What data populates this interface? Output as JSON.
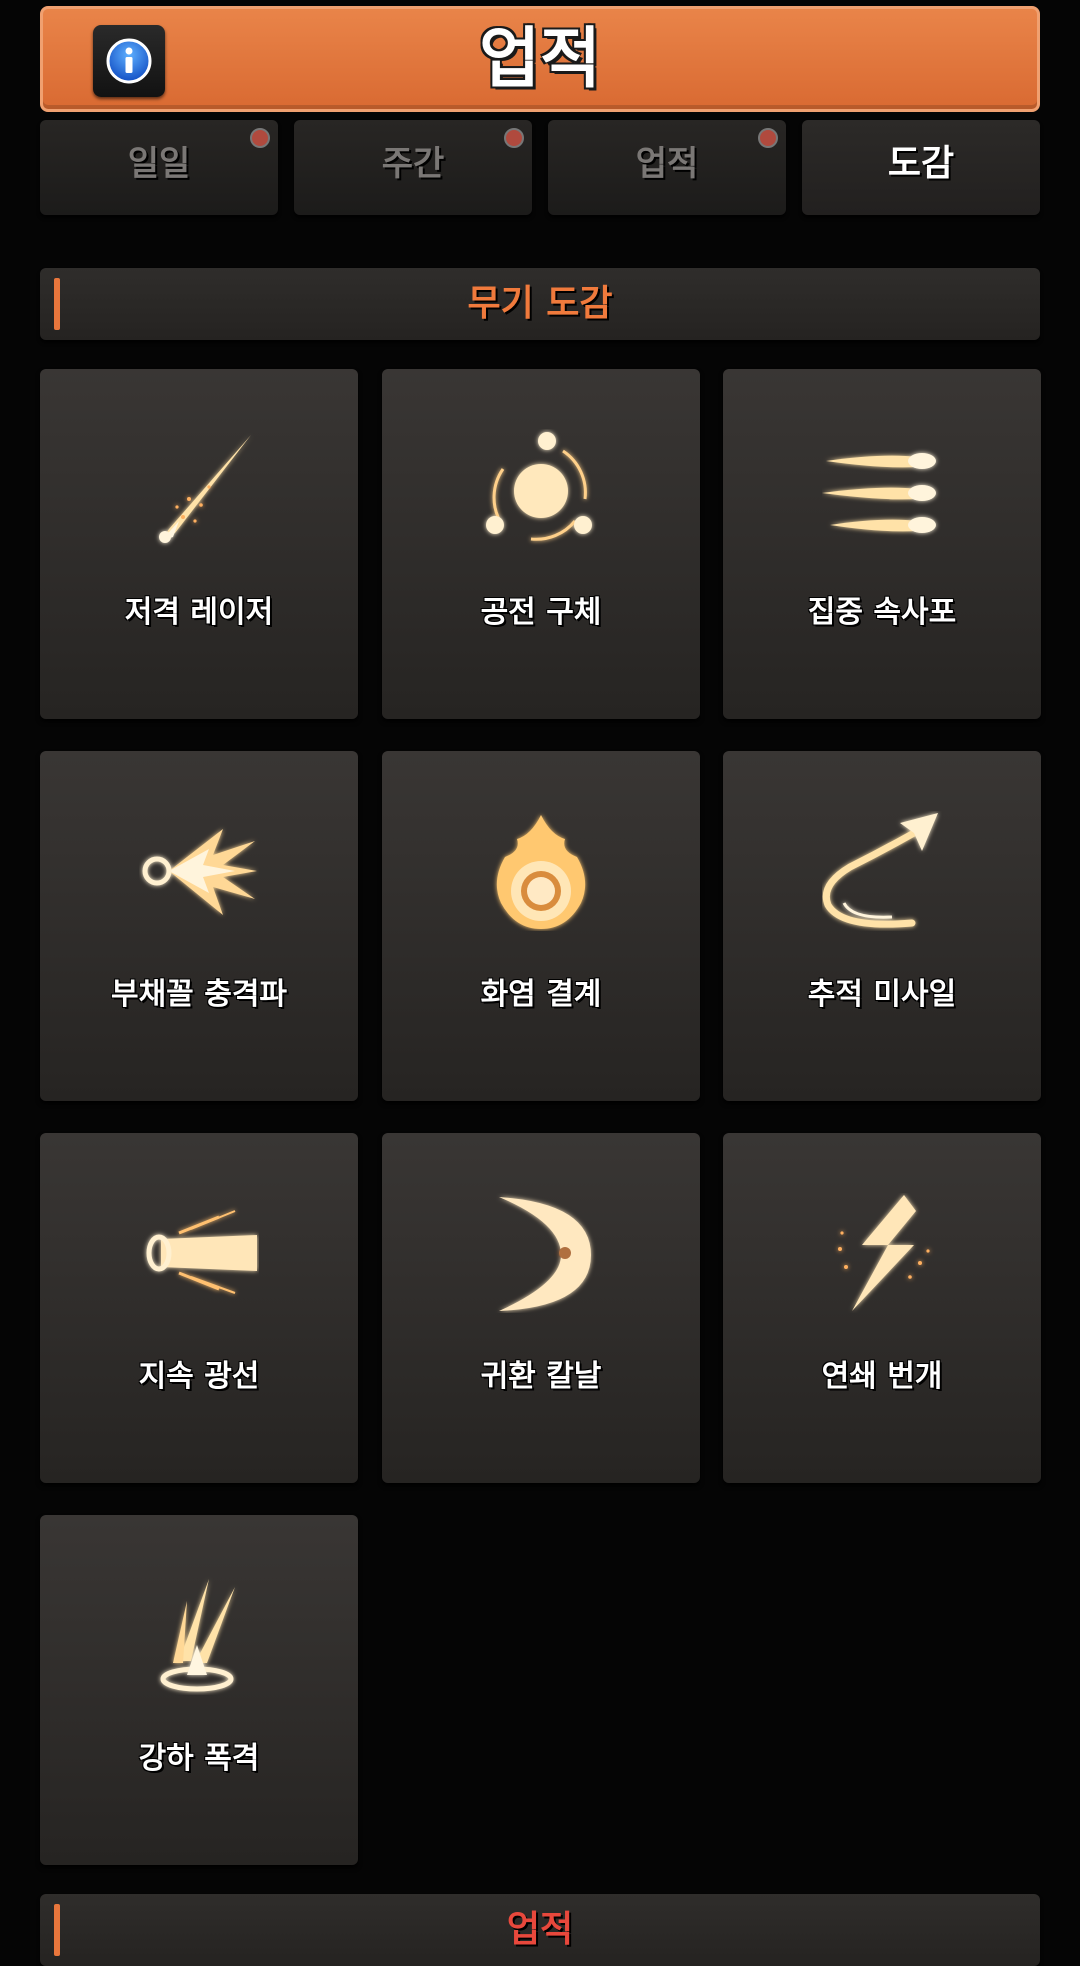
{
  "header": {
    "title": "업적",
    "info_icon": "info-icon"
  },
  "tabs": [
    {
      "label": "일일",
      "has_notification": true,
      "active": false
    },
    {
      "label": "주간",
      "has_notification": true,
      "active": false
    },
    {
      "label": "업적",
      "has_notification": true,
      "active": false
    },
    {
      "label": "도감",
      "has_notification": false,
      "active": true
    }
  ],
  "section": {
    "title": "무기 도감"
  },
  "weapons": [
    {
      "name": "저격 레이저",
      "icon": "sniper-laser-icon"
    },
    {
      "name": "공전 구체",
      "icon": "orbit-sphere-icon"
    },
    {
      "name": "집중 속사포",
      "icon": "rapid-fire-icon"
    },
    {
      "name": "부채꼴 충격파",
      "icon": "fan-shockwave-icon"
    },
    {
      "name": "화염 결계",
      "icon": "flame-barrier-icon"
    },
    {
      "name": "추적 미사일",
      "icon": "homing-missile-icon"
    },
    {
      "name": "지속 광선",
      "icon": "beam-icon"
    },
    {
      "name": "귀환 칼날",
      "icon": "crescent-blade-icon"
    },
    {
      "name": "연쇄 번개",
      "icon": "chain-lightning-icon"
    },
    {
      "name": "강하 폭격",
      "icon": "meteor-strike-icon"
    }
  ],
  "next_section": {
    "title": "업적"
  },
  "colors": {
    "accent": "#e8763c",
    "header": "#e27a40",
    "glow": "#ffe6b8"
  }
}
